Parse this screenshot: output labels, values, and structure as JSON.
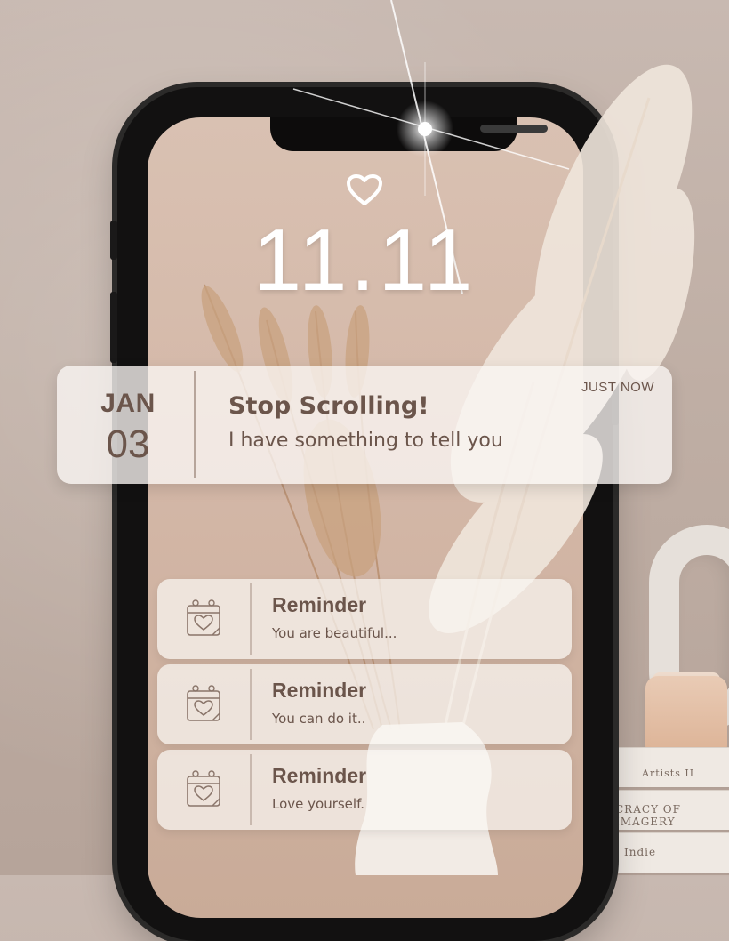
{
  "lockscreen": {
    "time": "11.11",
    "heart_icon": "heart-outline-icon"
  },
  "notification": {
    "month": "JAN",
    "day": "03",
    "title": "Stop Scrolling!",
    "body": "I have something to tell you",
    "time": "JUST NOW"
  },
  "reminders": [
    {
      "title": "Reminder",
      "body": "You are beautiful...",
      "icon": "calendar-heart-icon"
    },
    {
      "title": "Reminder",
      "body": "You can do it..",
      "icon": "calendar-heart-icon"
    },
    {
      "title": "Reminder",
      "body": "Love yourself.",
      "icon": "calendar-heart-icon"
    }
  ],
  "books": {
    "spine_1": "Artists II",
    "spine_2": "CRACY OF IMAGERY",
    "spine_3": "Indie"
  },
  "colors": {
    "text_brown": "#6b554b",
    "card_bg": "#faf6f3",
    "screen_bg": "#d4b8a8"
  }
}
